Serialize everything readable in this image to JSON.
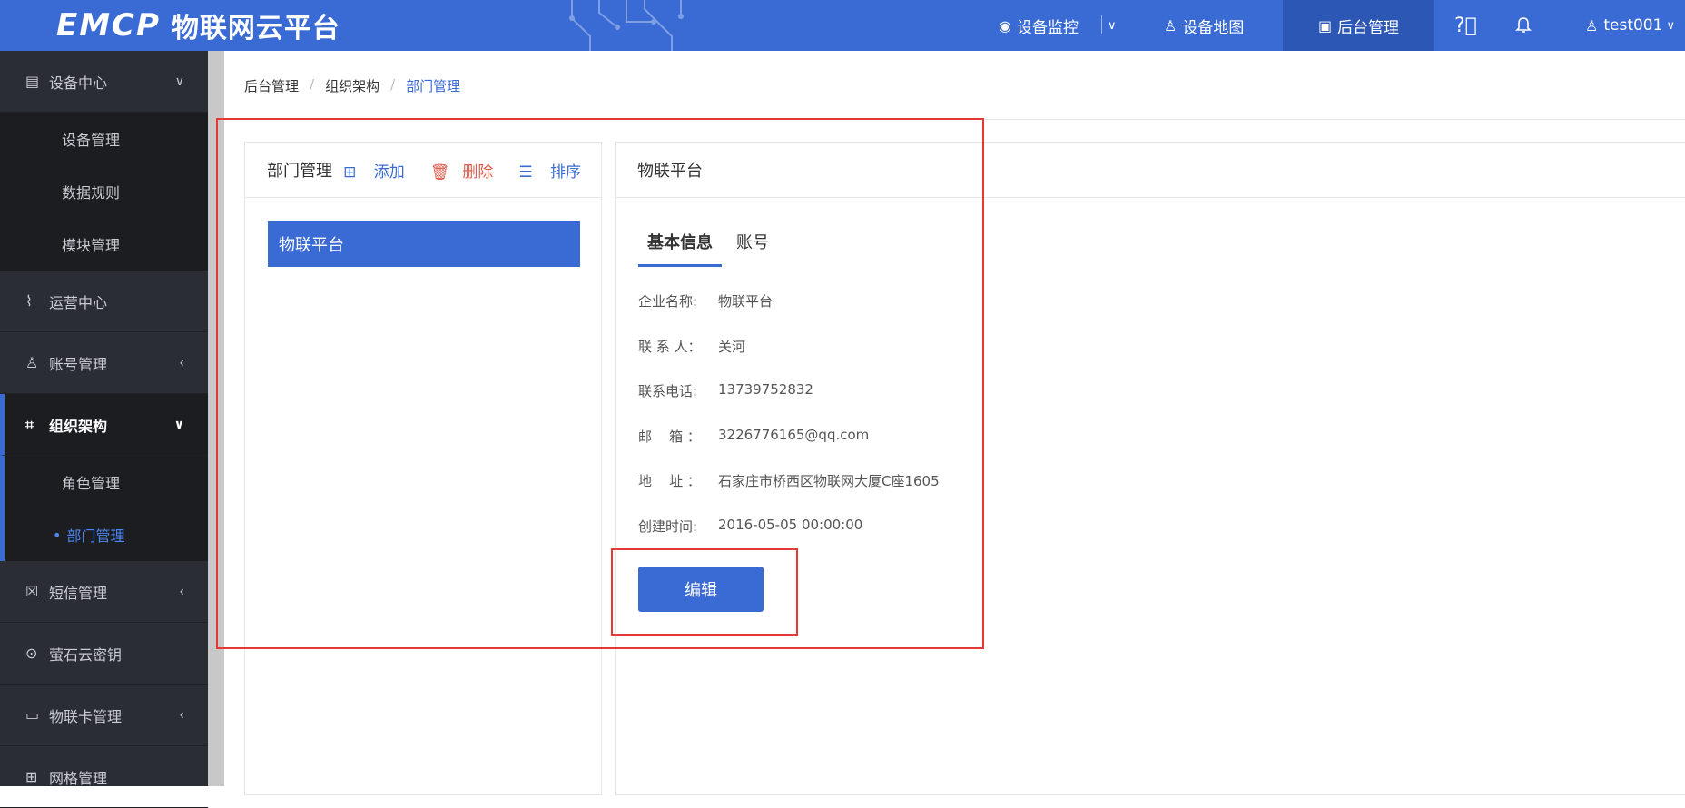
{
  "topbar": {
    "logo_mark": "EMCP",
    "logo_text": "物联网云平台",
    "nav": [
      {
        "label": "设备监控",
        "icon": "monitor-icon"
      },
      {
        "label": "设备地图",
        "icon": "user-map-icon"
      },
      {
        "label": "后台管理",
        "icon": "admin-icon"
      }
    ],
    "user": "test001"
  },
  "sidebar": {
    "groups": [
      {
        "label": "设备中心",
        "icon": "device-icon",
        "arrow": "down",
        "children": [
          "设备管理",
          "数据规则",
          "模块管理"
        ]
      },
      {
        "label": "运营中心",
        "icon": "chart-icon"
      },
      {
        "label": "账号管理",
        "icon": "user-icon",
        "arrow": "left"
      },
      {
        "label": "组织架构",
        "icon": "org-icon",
        "arrow": "down",
        "children": [
          "角色管理",
          "部门管理"
        ]
      },
      {
        "label": "短信管理",
        "icon": "sms-icon",
        "arrow": "left"
      },
      {
        "label": "萤石云密钥",
        "icon": "key-icon"
      },
      {
        "label": "物联卡管理",
        "icon": "card-icon",
        "arrow": "left"
      },
      {
        "label": "网格管理",
        "icon": "grid-icon"
      }
    ]
  },
  "breadcrumb": [
    "后台管理",
    "组织架构",
    "部门管理"
  ],
  "left_panel": {
    "title": "部门管理",
    "actions": {
      "add": "添加",
      "delete": "删除",
      "sort": "排序"
    },
    "items": [
      "物联平台"
    ]
  },
  "right_panel": {
    "title": "物联平台",
    "tabs": [
      "基本信息",
      "账号"
    ],
    "fields": [
      {
        "label": "企业名称:",
        "value": "物联平台"
      },
      {
        "label": "联 系 人：",
        "value": "关河"
      },
      {
        "label": "联系电话:",
        "value": "13739752832"
      },
      {
        "label": "邮    箱 ：",
        "value": "3226776165@qq.com"
      },
      {
        "label": "地    址 ：",
        "value": "石家庄市桥西区物联网大厦C座1605"
      },
      {
        "label": "创建时间:",
        "value": "2016-05-05 00:00:00"
      }
    ],
    "edit_label": "编辑"
  },
  "colors": {
    "primary": "#3a6bd4",
    "sidebar": "#2a2d33",
    "danger": "#e05a4a",
    "annotation": "#e53935"
  }
}
